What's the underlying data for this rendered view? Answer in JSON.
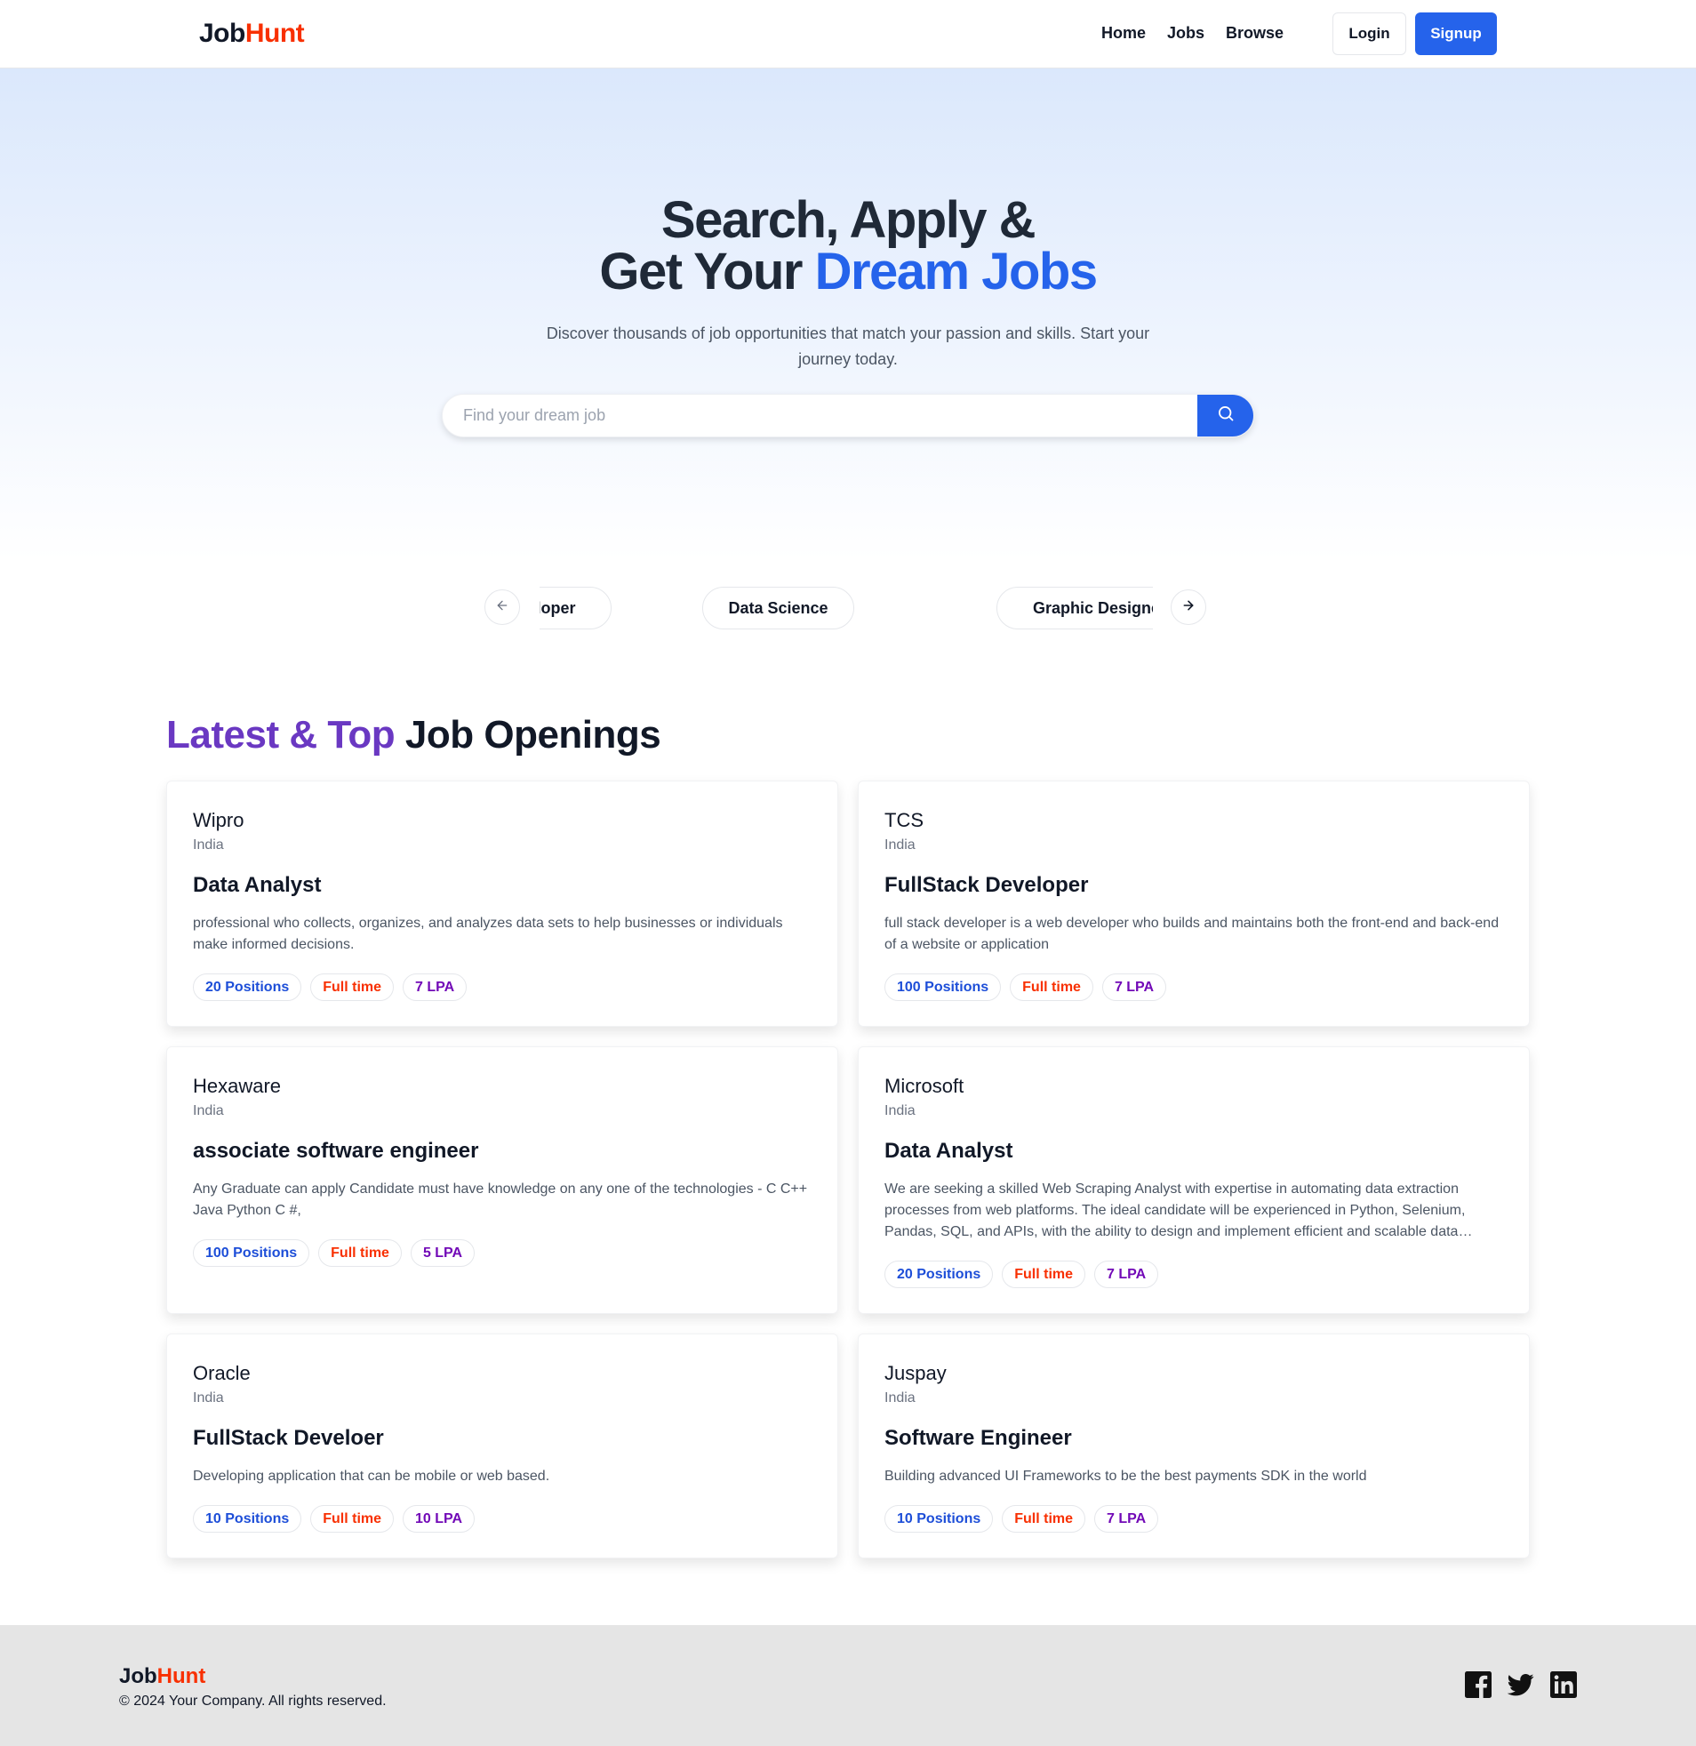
{
  "brand": {
    "part1": "Job",
    "part2": "Hunt",
    "accent_color": "#f83002"
  },
  "nav": {
    "links": [
      "Home",
      "Jobs",
      "Browse"
    ],
    "login_label": "Login",
    "signup_label": "Signup"
  },
  "hero": {
    "title_line1": "Search, Apply &",
    "title_line2_plain": "Get Your ",
    "title_line2_highlight": "Dream Jobs",
    "subtitle": "Discover thousands of job opportunities that match your passion and skills. Start your journey today.",
    "search_placeholder": "Find your dream job",
    "search_icon": "search-icon"
  },
  "categories": {
    "items": [
      "Frontend Developer",
      "Data Science",
      "Graphic Designer"
    ],
    "prev_icon": "arrow-left-icon",
    "next_icon": "arrow-right-icon"
  },
  "jobs_section": {
    "title_highlight": "Latest & Top",
    "title_plain": " Job Openings",
    "jobs": [
      {
        "company": "Wipro",
        "location": "India",
        "title": "Data Analyst",
        "description": "professional who collects, organizes, and analyzes data sets to help businesses or individuals make informed decisions.",
        "positions": "20 Positions",
        "type": "Full time",
        "salary": "7 LPA"
      },
      {
        "company": "TCS",
        "location": "India",
        "title": "FullStack Developer",
        "description": "full stack developer is a web developer who builds and maintains both the front-end and back-end of a website or application",
        "positions": "100 Positions",
        "type": "Full time",
        "salary": "7 LPA"
      },
      {
        "company": "Hexaware",
        "location": "India",
        "title": "associate software engineer",
        "description": "Any Graduate can apply Candidate must have knowledge on any one of the technologies - C C++ Java Python C #,",
        "positions": "100 Positions",
        "type": "Full time",
        "salary": "5 LPA"
      },
      {
        "company": "Microsoft",
        "location": "India",
        "title": "Data Analyst",
        "description": "We are seeking a skilled Web Scraping Analyst with expertise in automating data extraction processes from web platforms. The ideal candidate will be experienced in Python, Selenium, Pandas, SQL, and APIs, with the ability to design and implement efficient and scalable data scraping solutions.",
        "positions": "20 Positions",
        "type": "Full time",
        "salary": "7 LPA"
      },
      {
        "company": "Oracle",
        "location": "India",
        "title": "FullStack Develoer",
        "description": "Developing application that can be mobile or web based.",
        "positions": "10 Positions",
        "type": "Full time",
        "salary": "10 LPA"
      },
      {
        "company": "Juspay",
        "location": "India",
        "title": "Software Engineer",
        "description": "Building advanced UI Frameworks to be the best payments SDK in the world",
        "positions": "10 Positions",
        "type": "Full time",
        "salary": "7 LPA"
      }
    ]
  },
  "footer": {
    "copyright": "© 2024 Your Company. All rights reserved.",
    "social_icons": [
      "facebook-icon",
      "twitter-icon",
      "linkedin-icon"
    ]
  },
  "colors": {
    "primary": "#2563eb",
    "purple": "#6a38c2",
    "brand_red": "#f83002",
    "salary": "#7209b7",
    "positions": "#1d4ed8"
  }
}
